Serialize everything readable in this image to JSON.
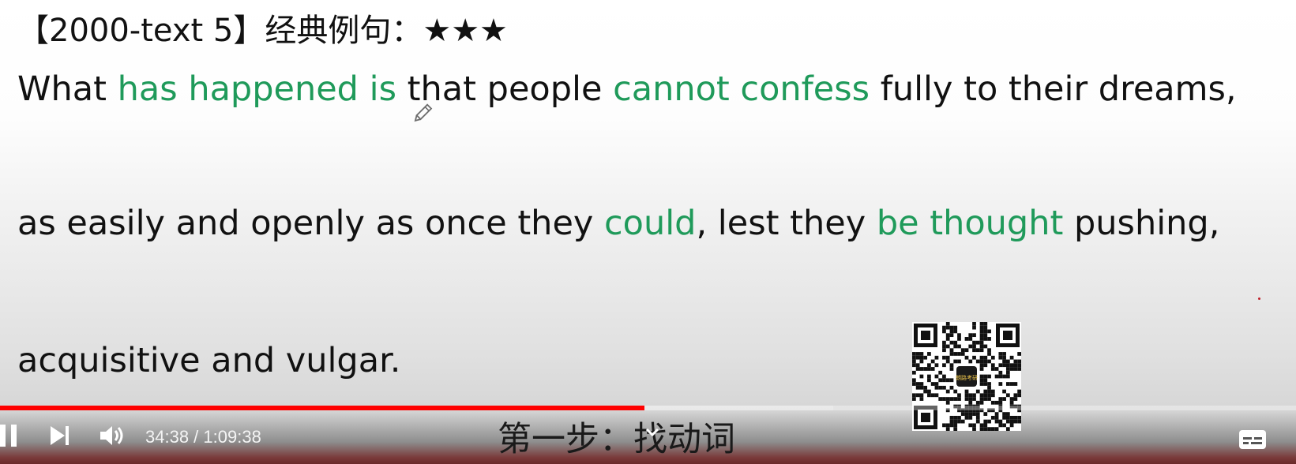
{
  "slide": {
    "title": "【2000-text 5】经典例句：★★★",
    "lines": [
      [
        {
          "text": "What ",
          "highlight": false
        },
        {
          "text": "has happened is",
          "highlight": true
        },
        {
          "text": " that people ",
          "highlight": false
        },
        {
          "text": "cannot confess",
          "highlight": true
        },
        {
          "text": " fully to their dreams,",
          "highlight": false
        }
      ],
      [
        {
          "text": "as easily and openly as once they ",
          "highlight": false
        },
        {
          "text": "could",
          "highlight": true
        },
        {
          "text": ", lest they ",
          "highlight": false
        },
        {
          "text": "be thought",
          "highlight": true
        },
        {
          "text": " pushing,",
          "highlight": false
        }
      ],
      [
        {
          "text": "acquisitive and vulgar.",
          "highlight": false
        }
      ]
    ],
    "highlight_color": "#1f9a5a",
    "subtitle": "第一步：找动词"
  },
  "watermark": {
    "qr_center_text": "朗路考研"
  },
  "player": {
    "current_time": "34:38",
    "separator": " / ",
    "duration": "1:09:38",
    "played_fraction": 0.4973,
    "buffered_fraction": 0.643,
    "progress_color": "#ff0000",
    "icons": {
      "pause": "pause-icon",
      "next": "next-icon",
      "volume": "volume-icon",
      "captions": "captions-icon",
      "chevron": "chevron-down-icon",
      "pencil": "pencil-cursor-icon"
    }
  }
}
